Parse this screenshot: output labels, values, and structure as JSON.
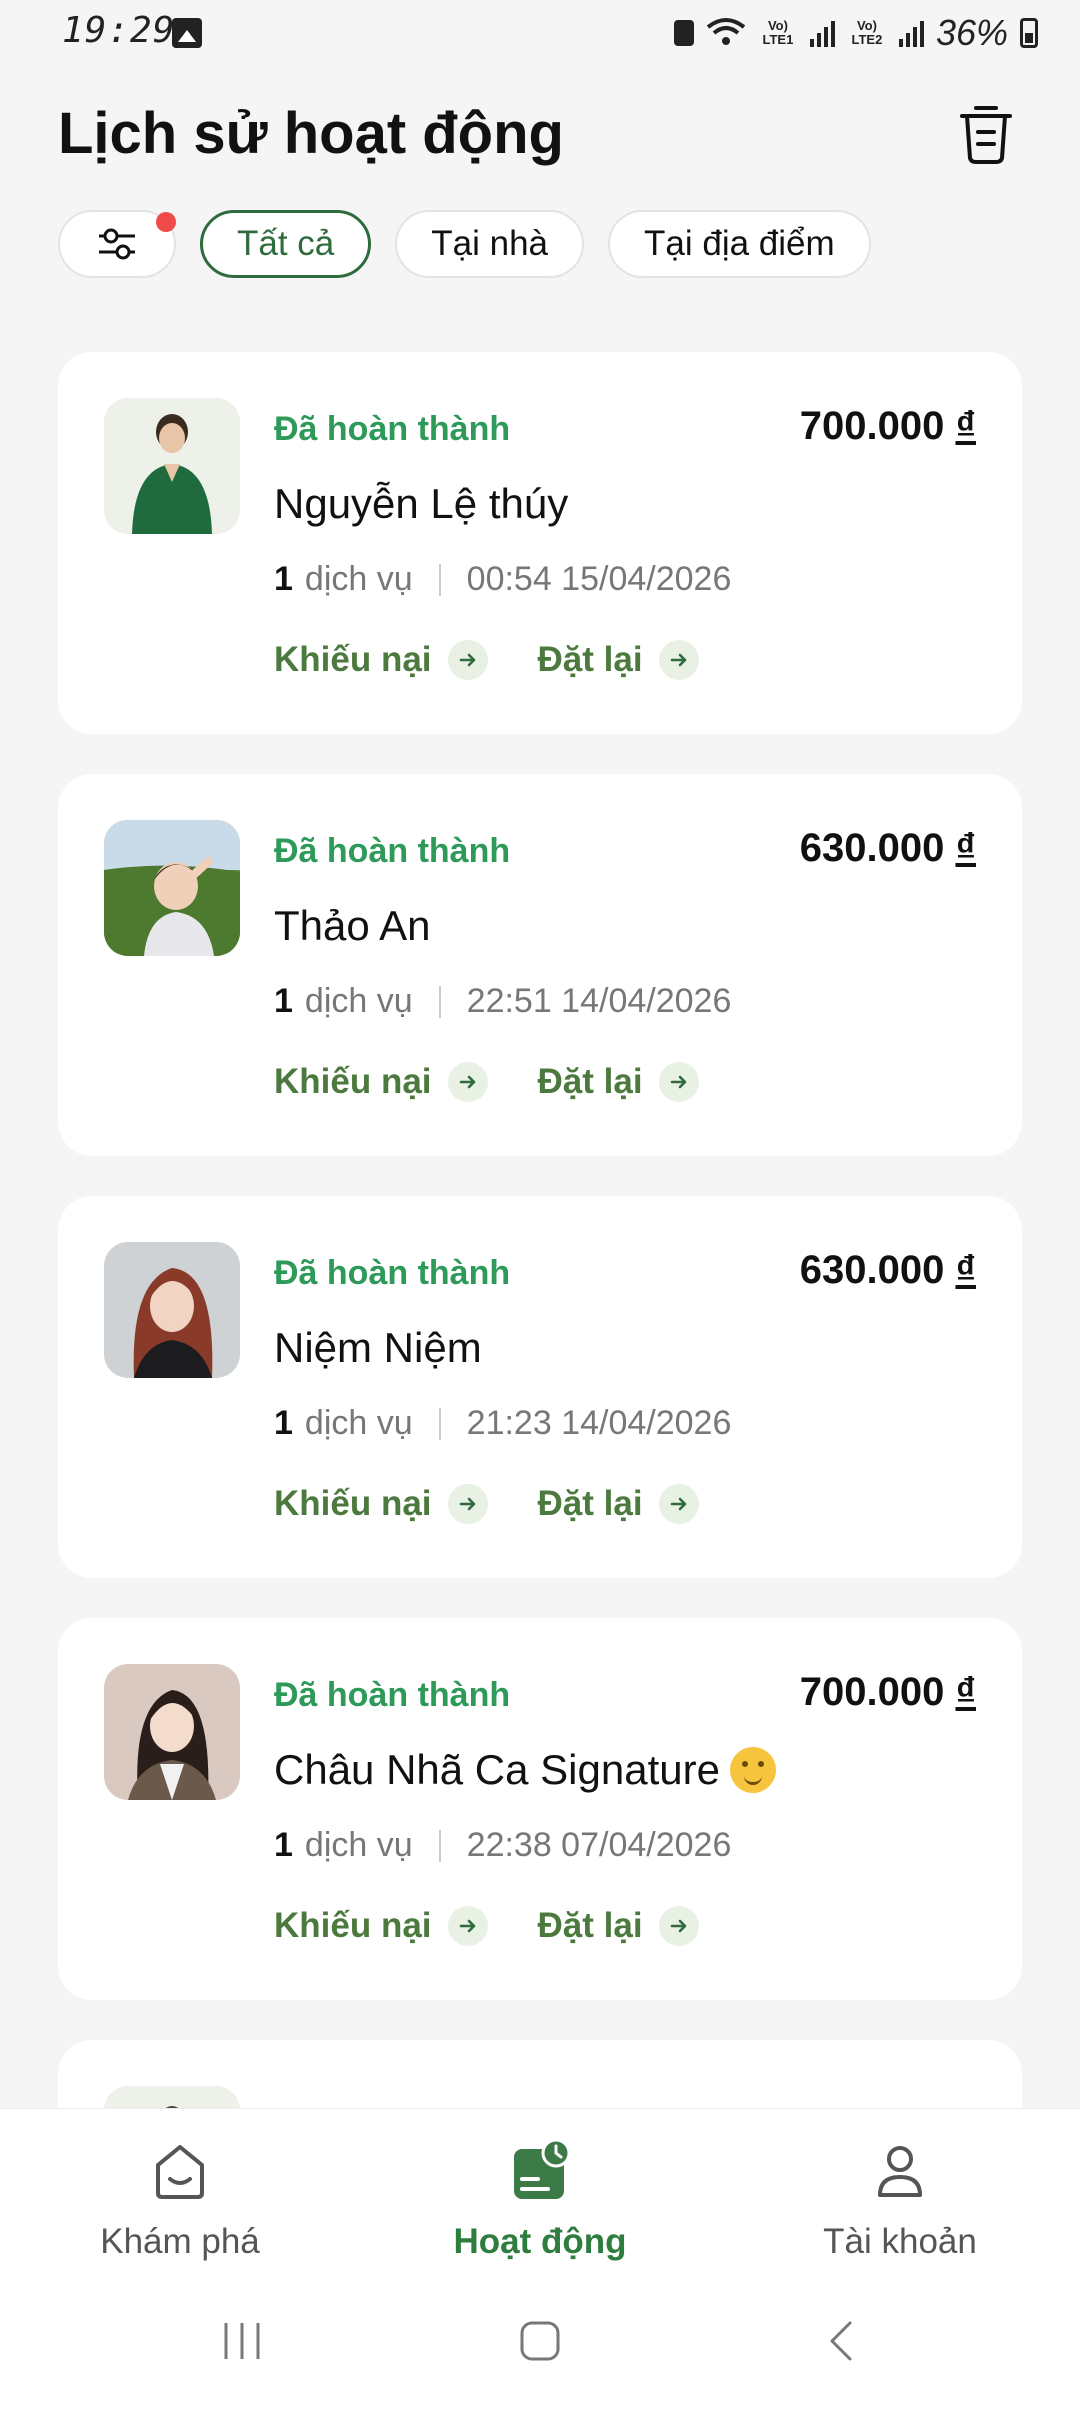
{
  "status_bar": {
    "time": "19:29",
    "lte1": "Vo) LTE1",
    "lte2": "Vo) LTE2",
    "battery": "36%"
  },
  "header": {
    "title": "Lịch sử hoạt động"
  },
  "filters": {
    "all": "Tất cả",
    "home": "Tại nhà",
    "location": "Tại địa điểm"
  },
  "colors": {
    "accent": "#2f6b3c",
    "status_green": "#2e9a5a",
    "badge_red": "#f04a4a"
  },
  "cards": [
    {
      "status": "Đã hoàn thành",
      "price": "700.000",
      "currency": "₫",
      "name": "Nguyễn Lệ thúy",
      "count": "1",
      "service_label": "dịch vụ",
      "datetime": "00:54 15/04/2026",
      "complain": "Khiếu nại",
      "rebook": "Đặt lại"
    },
    {
      "status": "Đã hoàn thành",
      "price": "630.000",
      "currency": "₫",
      "name": "Thảo An",
      "count": "1",
      "service_label": "dịch vụ",
      "datetime": "22:51 14/04/2026",
      "complain": "Khiếu nại",
      "rebook": "Đặt lại"
    },
    {
      "status": "Đã hoàn thành",
      "price": "630.000",
      "currency": "₫",
      "name": "Niệm Niệm",
      "count": "1",
      "service_label": "dịch vụ",
      "datetime": "21:23 14/04/2026",
      "complain": "Khiếu nại",
      "rebook": "Đặt lại"
    },
    {
      "status": "Đã hoàn thành",
      "price": "700.000",
      "currency": "₫",
      "name": "Châu Nhã Ca Signature",
      "count": "1",
      "service_label": "dịch vụ",
      "datetime": "22:38 07/04/2026",
      "complain": "Khiếu nại",
      "rebook": "Đặt lại"
    }
  ],
  "bottom_nav": {
    "explore": "Khám phá",
    "activity": "Hoạt động",
    "account": "Tài khoản"
  }
}
